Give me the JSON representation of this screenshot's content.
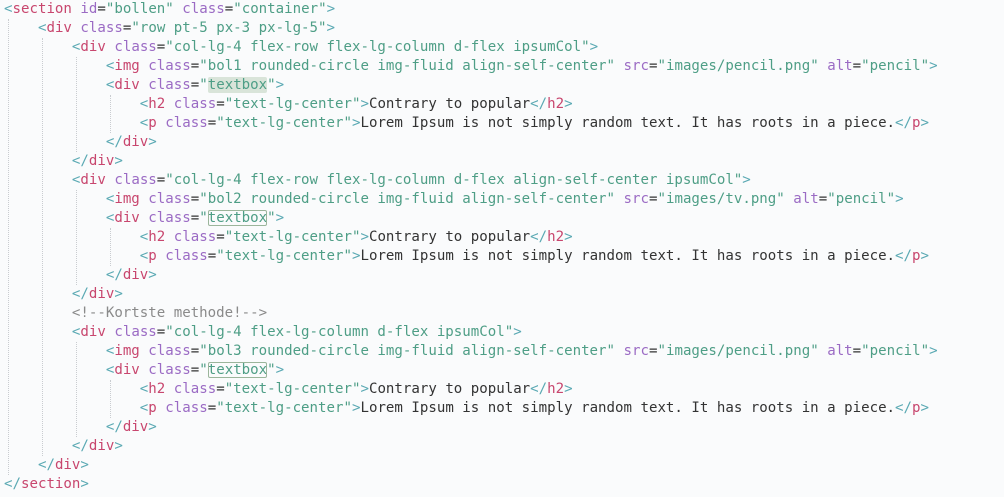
{
  "colors": {
    "background": "#fafbfc",
    "tag": "#c8466e",
    "attribute": "#9b6bc4",
    "string": "#4e9e86",
    "text": "#333333",
    "comment": "#8a8a8a",
    "bracket": "#5aa9b3"
  },
  "editor": {
    "lines": [
      {
        "indent": 0,
        "tokens": [
          [
            "b",
            "<"
          ],
          [
            "t",
            "section"
          ],
          [
            "x",
            " "
          ],
          [
            "a",
            "id"
          ],
          [
            "x",
            "="
          ],
          [
            "s",
            "\"bollen\""
          ],
          [
            "x",
            " "
          ],
          [
            "a",
            "class"
          ],
          [
            "x",
            "="
          ],
          [
            "s",
            "\"container\""
          ],
          [
            "b",
            ">"
          ]
        ]
      },
      {
        "indent": 1,
        "tokens": [
          [
            "b",
            "<"
          ],
          [
            "t",
            "div"
          ],
          [
            "x",
            " "
          ],
          [
            "a",
            "class"
          ],
          [
            "x",
            "="
          ],
          [
            "s",
            "\"row pt-5 px-3 px-lg-5\""
          ],
          [
            "b",
            ">"
          ]
        ]
      },
      {
        "indent": 2,
        "tokens": [
          [
            "b",
            "<"
          ],
          [
            "t",
            "div"
          ],
          [
            "x",
            " "
          ],
          [
            "a",
            "class"
          ],
          [
            "x",
            "="
          ],
          [
            "s",
            "\"col-lg-4 flex-row flex-lg-column d-flex ipsumCol\""
          ],
          [
            "b",
            ">"
          ]
        ]
      },
      {
        "indent": 3,
        "tokens": [
          [
            "b",
            "<"
          ],
          [
            "t",
            "img"
          ],
          [
            "x",
            " "
          ],
          [
            "a",
            "class"
          ],
          [
            "x",
            "="
          ],
          [
            "s",
            "\"bol1 rounded-circle img-fluid align-self-center\""
          ],
          [
            "x",
            " "
          ],
          [
            "a",
            "src"
          ],
          [
            "x",
            "="
          ],
          [
            "s",
            "\"images/pencil.png\""
          ],
          [
            "x",
            " "
          ],
          [
            "a",
            "alt"
          ],
          [
            "x",
            "="
          ],
          [
            "s",
            "\"pencil\""
          ],
          [
            "b",
            ">"
          ]
        ]
      },
      {
        "indent": 3,
        "tokens": [
          [
            "b",
            "<"
          ],
          [
            "t",
            "div"
          ],
          [
            "x",
            " "
          ],
          [
            "a",
            "class"
          ],
          [
            "x",
            "="
          ],
          [
            "s",
            "\""
          ],
          [
            "sh",
            "textbox"
          ],
          [
            "s",
            "\""
          ],
          [
            "b",
            ">"
          ]
        ]
      },
      {
        "indent": 4,
        "tokens": [
          [
            "b",
            "<"
          ],
          [
            "t",
            "h2"
          ],
          [
            "x",
            " "
          ],
          [
            "a",
            "class"
          ],
          [
            "x",
            "="
          ],
          [
            "s",
            "\"text-lg-center\""
          ],
          [
            "b",
            ">"
          ],
          [
            "x",
            "Contrary to popular"
          ],
          [
            "b",
            "</"
          ],
          [
            "t",
            "h2"
          ],
          [
            "b",
            ">"
          ]
        ]
      },
      {
        "indent": 4,
        "tokens": [
          [
            "b",
            "<"
          ],
          [
            "t",
            "p"
          ],
          [
            "x",
            " "
          ],
          [
            "a",
            "class"
          ],
          [
            "x",
            "="
          ],
          [
            "s",
            "\"text-lg-center\""
          ],
          [
            "b",
            ">"
          ],
          [
            "x",
            "Lorem Ipsum is not simply random text. It has roots in a piece."
          ],
          [
            "b",
            "</"
          ],
          [
            "t",
            "p"
          ],
          [
            "b",
            ">"
          ]
        ]
      },
      {
        "indent": 3,
        "tokens": [
          [
            "b",
            "</"
          ],
          [
            "t",
            "div"
          ],
          [
            "b",
            ">"
          ]
        ]
      },
      {
        "indent": 2,
        "tokens": [
          [
            "b",
            "</"
          ],
          [
            "t",
            "div"
          ],
          [
            "b",
            ">"
          ]
        ]
      },
      {
        "indent": 2,
        "tokens": [
          [
            "b",
            "<"
          ],
          [
            "t",
            "div"
          ],
          [
            "x",
            " "
          ],
          [
            "a",
            "class"
          ],
          [
            "x",
            "="
          ],
          [
            "s",
            "\"col-lg-4 flex-row flex-lg-column d-flex align-self-center ipsumCol\""
          ],
          [
            "b",
            ">"
          ]
        ]
      },
      {
        "indent": 3,
        "tokens": [
          [
            "b",
            "<"
          ],
          [
            "t",
            "img"
          ],
          [
            "x",
            " "
          ],
          [
            "a",
            "class"
          ],
          [
            "x",
            "="
          ],
          [
            "s",
            "\"bol2 rounded-circle img-fluid align-self-center\""
          ],
          [
            "x",
            " "
          ],
          [
            "a",
            "src"
          ],
          [
            "x",
            "="
          ],
          [
            "s",
            "\"images/tv.png\""
          ],
          [
            "x",
            " "
          ],
          [
            "a",
            "alt"
          ],
          [
            "x",
            "="
          ],
          [
            "s",
            "\"pencil\""
          ],
          [
            "b",
            ">"
          ]
        ]
      },
      {
        "indent": 3,
        "tokens": [
          [
            "b",
            "<"
          ],
          [
            "t",
            "div"
          ],
          [
            "x",
            " "
          ],
          [
            "a",
            "class"
          ],
          [
            "x",
            "="
          ],
          [
            "s",
            "\""
          ],
          [
            "sb",
            "textbox"
          ],
          [
            "s",
            "\""
          ],
          [
            "b",
            ">"
          ]
        ]
      },
      {
        "indent": 4,
        "tokens": [
          [
            "b",
            "<"
          ],
          [
            "t",
            "h2"
          ],
          [
            "x",
            " "
          ],
          [
            "a",
            "class"
          ],
          [
            "x",
            "="
          ],
          [
            "s",
            "\"text-lg-center\""
          ],
          [
            "b",
            ">"
          ],
          [
            "x",
            "Contrary to popular"
          ],
          [
            "b",
            "</"
          ],
          [
            "t",
            "h2"
          ],
          [
            "b",
            ">"
          ]
        ]
      },
      {
        "indent": 4,
        "tokens": [
          [
            "b",
            "<"
          ],
          [
            "t",
            "p"
          ],
          [
            "x",
            " "
          ],
          [
            "a",
            "class"
          ],
          [
            "x",
            "="
          ],
          [
            "s",
            "\"text-lg-center\""
          ],
          [
            "b",
            ">"
          ],
          [
            "x",
            "Lorem Ipsum is not simply random text. It has roots in a piece."
          ],
          [
            "b",
            "</"
          ],
          [
            "t",
            "p"
          ],
          [
            "b",
            ">"
          ]
        ]
      },
      {
        "indent": 3,
        "tokens": [
          [
            "b",
            "</"
          ],
          [
            "t",
            "div"
          ],
          [
            "b",
            ">"
          ]
        ]
      },
      {
        "indent": 2,
        "tokens": [
          [
            "b",
            "</"
          ],
          [
            "t",
            "div"
          ],
          [
            "b",
            ">"
          ]
        ]
      },
      {
        "indent": 2,
        "tokens": [
          [
            "c",
            "<!--Kortste methode!-->"
          ]
        ]
      },
      {
        "indent": 2,
        "tokens": [
          [
            "b",
            "<"
          ],
          [
            "t",
            "div"
          ],
          [
            "x",
            " "
          ],
          [
            "a",
            "class"
          ],
          [
            "x",
            "="
          ],
          [
            "s",
            "\"col-lg-4 flex-lg-column d-flex ipsumCol\""
          ],
          [
            "b",
            ">"
          ]
        ]
      },
      {
        "indent": 3,
        "tokens": [
          [
            "b",
            "<"
          ],
          [
            "t",
            "img"
          ],
          [
            "x",
            " "
          ],
          [
            "a",
            "class"
          ],
          [
            "x",
            "="
          ],
          [
            "s",
            "\"bol3 rounded-circle img-fluid align-self-center\""
          ],
          [
            "x",
            " "
          ],
          [
            "a",
            "src"
          ],
          [
            "x",
            "="
          ],
          [
            "s",
            "\"images/pencil.png\""
          ],
          [
            "x",
            " "
          ],
          [
            "a",
            "alt"
          ],
          [
            "x",
            "="
          ],
          [
            "s",
            "\"pencil\""
          ],
          [
            "b",
            ">"
          ]
        ]
      },
      {
        "indent": 3,
        "tokens": [
          [
            "b",
            "<"
          ],
          [
            "t",
            "div"
          ],
          [
            "x",
            " "
          ],
          [
            "a",
            "class"
          ],
          [
            "x",
            "="
          ],
          [
            "s",
            "\""
          ],
          [
            "sb",
            "textbox"
          ],
          [
            "s",
            "\""
          ],
          [
            "b",
            ">"
          ]
        ]
      },
      {
        "indent": 4,
        "tokens": [
          [
            "b",
            "<"
          ],
          [
            "t",
            "h2"
          ],
          [
            "x",
            " "
          ],
          [
            "a",
            "class"
          ],
          [
            "x",
            "="
          ],
          [
            "s",
            "\"text-lg-center\""
          ],
          [
            "b",
            ">"
          ],
          [
            "x",
            "Contrary to popular"
          ],
          [
            "b",
            "</"
          ],
          [
            "t",
            "h2"
          ],
          [
            "b",
            ">"
          ]
        ]
      },
      {
        "indent": 4,
        "tokens": [
          [
            "b",
            "<"
          ],
          [
            "t",
            "p"
          ],
          [
            "x",
            " "
          ],
          [
            "a",
            "class"
          ],
          [
            "x",
            "="
          ],
          [
            "s",
            "\"text-lg-center\""
          ],
          [
            "b",
            ">"
          ],
          [
            "x",
            "Lorem Ipsum is not simply random text. It has roots in a piece."
          ],
          [
            "b",
            "</"
          ],
          [
            "t",
            "p"
          ],
          [
            "b",
            ">"
          ]
        ]
      },
      {
        "indent": 3,
        "tokens": [
          [
            "b",
            "</"
          ],
          [
            "t",
            "div"
          ],
          [
            "b",
            ">"
          ]
        ]
      },
      {
        "indent": 2,
        "tokens": [
          [
            "b",
            "</"
          ],
          [
            "t",
            "div"
          ],
          [
            "b",
            ">"
          ]
        ]
      },
      {
        "indent": 1,
        "tokens": [
          [
            "b",
            "</"
          ],
          [
            "t",
            "div"
          ],
          [
            "b",
            ">"
          ]
        ]
      },
      {
        "indent": 0,
        "tokens": [
          [
            "b",
            "</"
          ],
          [
            "t",
            "section"
          ],
          [
            "b",
            ">"
          ]
        ]
      }
    ]
  }
}
